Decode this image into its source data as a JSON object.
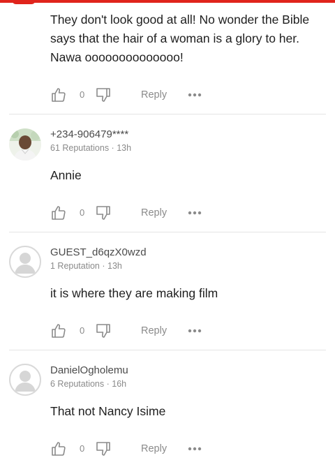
{
  "comments": [
    {
      "body": "They don't look good at all! No wonder the Bible says that the hair of a woman is a glory to her. Nawa oooooooooooooo!",
      "likes": "0",
      "reply_label": "Reply"
    },
    {
      "username": "+234-906479****",
      "meta": "61 Reputations · 13h",
      "body": "Annie",
      "likes": "0",
      "reply_label": "Reply"
    },
    {
      "username": "GUEST_d6qzX0wzd",
      "meta": "1 Reputation · 13h",
      "body": "it is where they are making film",
      "likes": "0",
      "reply_label": "Reply"
    },
    {
      "username": "DanielOgholemu",
      "meta": "6 Reputations · 16h",
      "body": "That not Nancy Isime",
      "likes": "0",
      "reply_label": "Reply"
    }
  ],
  "icons": {
    "like": "thumbs-up-icon",
    "dislike": "thumbs-down-icon",
    "more": "more-dots-icon",
    "avatar_default": "default-user-avatar"
  },
  "colors": {
    "accent": "#e0241c",
    "meta_text": "#8a8a8a",
    "divider": "#e4e4e4"
  }
}
